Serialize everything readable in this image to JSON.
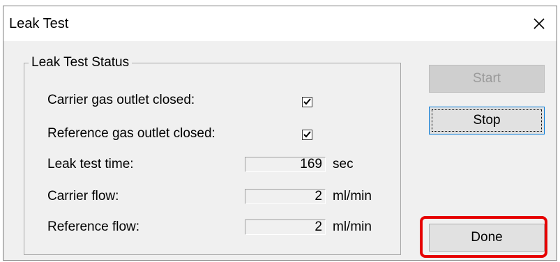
{
  "window": {
    "title": "Leak Test"
  },
  "group": {
    "legend": "Leak Test Status",
    "rows": [
      {
        "label": "Carrier gas outlet closed:",
        "checked": true
      },
      {
        "label": "Reference gas outlet closed:",
        "checked": true
      }
    ],
    "fields": [
      {
        "label": "Leak test time:",
        "value": "169",
        "unit": "sec"
      },
      {
        "label": "Carrier flow:",
        "value": "2",
        "unit": "ml/min"
      },
      {
        "label": "Reference flow:",
        "value": "2",
        "unit": "ml/min"
      }
    ]
  },
  "buttons": {
    "start": "Start",
    "stop": "Stop",
    "done": "Done"
  },
  "colors": {
    "highlight": "#e60000",
    "dialog_bg": "#f0f0f0"
  },
  "icons": {
    "close": "close-icon",
    "check": "check-icon"
  }
}
